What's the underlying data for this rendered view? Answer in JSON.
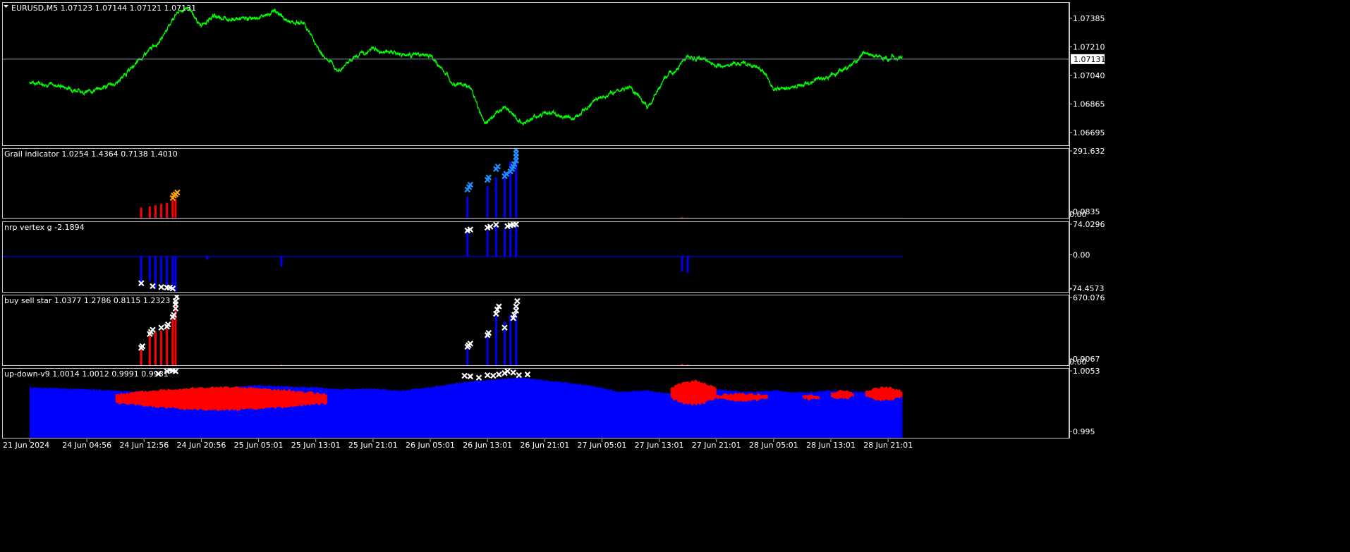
{
  "window": {
    "symbol_title": "EURUSD,M5",
    "ohlc": "1.07123 1.07144 1.07121 1.07131"
  },
  "colors": {
    "background": "#000000",
    "frame": "#c8c8c8",
    "price_line": "#00ff00",
    "bid_line": "#7a8ea8",
    "red": "#ff0000",
    "blue": "#0000ff",
    "light_blue": "#1e90ff",
    "orange": "#ffa500",
    "white": "#ffffff"
  },
  "icons": {
    "dropdown": "triangle-down-icon",
    "marker": "cross-x-icon"
  },
  "time_axis": {
    "labels": [
      "21 Jun 2024",
      "24 Jun 04:56",
      "24 Jun 12:56",
      "24 Jun 20:56",
      "25 Jun 05:01",
      "25 Jun 13:01",
      "25 Jun 21:01",
      "26 Jun 05:01",
      "26 Jun 13:01",
      "26 Jun 21:01",
      "27 Jun 05:01",
      "27 Jun 13:01",
      "27 Jun 21:01",
      "28 Jun 05:01",
      "28 Jun 13:01",
      "28 Jun 21:01"
    ]
  },
  "chart_data": [
    {
      "type": "line",
      "name": "main-price",
      "title": "EURUSD,M5  1.07123 1.07144 1.07121 1.07131",
      "y_ticks": [
        "1.07385",
        "1.07210",
        "1.07040",
        "1.06865",
        "1.06695"
      ],
      "ylim": [
        1.0663,
        1.0746
      ],
      "current_price_label": "1.07131",
      "current_price": 1.07131,
      "x_categories_are_time_axis_labels": true,
      "price_anchors": [
        [
          0,
          1.07
        ],
        [
          0.5,
          1.0698
        ],
        [
          1,
          1.0694
        ],
        [
          1.5,
          1.0699
        ],
        [
          2,
          1.0715
        ],
        [
          2.3,
          1.0725
        ],
        [
          2.55,
          1.0739
        ],
        [
          2.75,
          1.0743
        ],
        [
          3,
          1.0732
        ],
        [
          3.2,
          1.0738
        ],
        [
          3.6,
          1.0736
        ],
        [
          4,
          1.0737
        ],
        [
          4.3,
          1.0741
        ],
        [
          4.5,
          1.0735
        ],
        [
          4.8,
          1.0734
        ],
        [
          5.1,
          1.0716
        ],
        [
          5.4,
          1.0706
        ],
        [
          5.6,
          1.0713
        ],
        [
          6,
          1.0719
        ],
        [
          6.5,
          1.0716
        ],
        [
          7,
          1.0715
        ],
        [
          7.4,
          1.07
        ],
        [
          7.7,
          1.0697
        ],
        [
          7.95,
          1.0676
        ],
        [
          8.3,
          1.0686
        ],
        [
          8.6,
          1.0676
        ],
        [
          9,
          1.0682
        ],
        [
          9.5,
          1.0679
        ],
        [
          10,
          1.0692
        ],
        [
          10.5,
          1.0697
        ],
        [
          10.8,
          1.0685
        ],
        [
          11.1,
          1.0702
        ],
        [
          11.5,
          1.0714
        ],
        [
          11.8,
          1.0713
        ],
        [
          12,
          1.0709
        ],
        [
          12.5,
          1.0711
        ],
        [
          12.8,
          1.0707
        ],
        [
          13,
          1.0695
        ],
        [
          13.3,
          1.0697
        ],
        [
          13.7,
          1.07
        ],
        [
          14,
          1.0704
        ],
        [
          14.3,
          1.0708
        ],
        [
          14.6,
          1.0717
        ],
        [
          15,
          1.0713
        ],
        [
          15.25,
          1.0715
        ]
      ]
    },
    {
      "type": "bar",
      "name": "Grail indicator",
      "title": "Grail indicator 1.0254 1.4364 0.7138 1.4010",
      "y_ticks": [
        "291.632",
        "0.0835",
        "0.00"
      ],
      "ylim": [
        0,
        291.632
      ],
      "series": [
        {
          "name": "red",
          "color": "red",
          "bars": [
            [
              1.95,
              45
            ],
            [
              2.1,
              50
            ],
            [
              2.2,
              55
            ],
            [
              2.3,
              60
            ],
            [
              2.4,
              65
            ],
            [
              2.5,
              75
            ],
            [
              2.55,
              80
            ],
            [
              11.4,
              6
            ],
            [
              11.5,
              4
            ]
          ]
        },
        {
          "name": "blue",
          "color": "blue",
          "bars": [
            [
              7.65,
              90
            ],
            [
              8.0,
              135
            ],
            [
              8.15,
              170
            ],
            [
              8.3,
              190
            ],
            [
              8.4,
              235
            ],
            [
              8.5,
              270
            ]
          ]
        }
      ],
      "markers": [
        {
          "color": "orange",
          "points": [
            [
              2.5,
              85
            ],
            [
              2.52,
              95
            ],
            [
              2.55,
              100
            ],
            [
              2.58,
              108
            ]
          ]
        },
        {
          "color": "light_blue",
          "points": [
            [
              7.65,
              120
            ],
            [
              7.68,
              130
            ],
            [
              7.7,
              140
            ],
            [
              8.0,
              160
            ],
            [
              8.02,
              170
            ],
            [
              8.15,
              205
            ],
            [
              8.18,
              215
            ],
            [
              8.3,
              175
            ],
            [
              8.33,
              185
            ],
            [
              8.4,
              195
            ],
            [
              8.43,
              205
            ],
            [
              8.45,
              215
            ],
            [
              8.47,
              225
            ],
            [
              8.5,
              240
            ],
            [
              8.5,
              255
            ],
            [
              8.5,
              270
            ],
            [
              8.5,
              285
            ]
          ]
        }
      ]
    },
    {
      "type": "bar",
      "name": "nrp vertex g",
      "title": "nrp vertex g -2.1894",
      "y_ticks": [
        "74.0296",
        "0.00",
        "-74.4573"
      ],
      "ylim": [
        -74.4573,
        74.0296
      ],
      "series": [
        {
          "name": "blue",
          "color": "blue",
          "bars": [
            [
              1.95,
              -60
            ],
            [
              2.1,
              -50
            ],
            [
              2.2,
              -65
            ],
            [
              2.3,
              -55
            ],
            [
              2.4,
              -62
            ],
            [
              2.5,
              -70
            ],
            [
              2.55,
              -72
            ],
            [
              3.1,
              -6
            ],
            [
              4.4,
              -20
            ],
            [
              7.65,
              55
            ],
            [
              8.0,
              55
            ],
            [
              8.15,
              65
            ],
            [
              8.3,
              58
            ],
            [
              8.4,
              60
            ],
            [
              8.5,
              65
            ],
            [
              11.4,
              -30
            ],
            [
              11.5,
              -33
            ]
          ]
        }
      ],
      "markers": [
        {
          "color": "white",
          "points": [
            [
              1.95,
              -55
            ],
            [
              2.15,
              -61
            ],
            [
              2.3,
              -63
            ],
            [
              2.4,
              -64
            ],
            [
              2.45,
              -64
            ],
            [
              2.5,
              -66
            ],
            [
              7.65,
              55
            ],
            [
              7.7,
              57
            ],
            [
              8.0,
              61
            ],
            [
              8.05,
              63
            ],
            [
              8.15,
              67
            ],
            [
              8.35,
              64
            ],
            [
              8.4,
              66
            ],
            [
              8.45,
              67
            ],
            [
              8.5,
              68
            ]
          ]
        }
      ]
    },
    {
      "type": "bar",
      "name": "buy sell star",
      "title": "buy sell star 1.0377 1.2786 0.8115 1.2323",
      "y_ticks": [
        "670.076",
        "0.9067",
        "0.00"
      ],
      "ylim": [
        0,
        670.076
      ],
      "series": [
        {
          "name": "red",
          "color": "red",
          "bars": [
            [
              1.95,
              180
            ],
            [
              2.1,
              290
            ],
            [
              2.2,
              320
            ],
            [
              2.3,
              330
            ],
            [
              2.4,
              350
            ],
            [
              2.5,
              440
            ],
            [
              2.55,
              620
            ],
            [
              3.1,
              8
            ],
            [
              4.4,
              12
            ],
            [
              11.4,
              18
            ],
            [
              11.5,
              14
            ]
          ]
        },
        {
          "name": "blue",
          "color": "blue",
          "bars": [
            [
              7.65,
              190
            ],
            [
              8.0,
              310
            ],
            [
              8.15,
              470
            ],
            [
              8.3,
              420
            ],
            [
              8.4,
              480
            ],
            [
              8.5,
              560
            ]
          ]
        }
      ],
      "markers": [
        {
          "color": "white",
          "points": [
            [
              1.95,
              170
            ],
            [
              1.97,
              185
            ],
            [
              2.1,
              300
            ],
            [
              2.12,
              320
            ],
            [
              2.15,
              340
            ],
            [
              2.3,
              360
            ],
            [
              2.4,
              370
            ],
            [
              2.42,
              390
            ],
            [
              2.5,
              460
            ],
            [
              2.52,
              480
            ],
            [
              2.55,
              540
            ],
            [
              2.55,
              580
            ],
            [
              2.55,
              610
            ],
            [
              2.57,
              650
            ],
            [
              7.65,
              180
            ],
            [
              7.67,
              195
            ],
            [
              7.7,
              210
            ],
            [
              8.0,
              290
            ],
            [
              8.02,
              310
            ],
            [
              8.15,
              490
            ],
            [
              8.17,
              530
            ],
            [
              8.2,
              560
            ],
            [
              8.3,
              360
            ],
            [
              8.45,
              450
            ],
            [
              8.47,
              480
            ],
            [
              8.5,
              520
            ],
            [
              8.5,
              560
            ],
            [
              8.52,
              610
            ]
          ]
        }
      ]
    },
    {
      "type": "area",
      "name": "up-down-v9",
      "title": "up-down-v9 1.0014 1.0012 0.9991 0.9981",
      "y_ticks": [
        "1.0053",
        "0.995"
      ],
      "ylim": [
        0.9946,
        1.0055
      ],
      "series": [
        {
          "name": "blue-area",
          "color": "blue",
          "top": [
            [
              0,
              1.0025
            ],
            [
              1,
              1.0022
            ],
            [
              2,
              1.0018
            ],
            [
              2.5,
              1.002
            ],
            [
              3,
              1.0022
            ],
            [
              4,
              1.0028
            ],
            [
              5,
              1.0025
            ],
            [
              5.4,
              1.0022
            ],
            [
              6,
              1.0023
            ],
            [
              6.5,
              1.002
            ],
            [
              7,
              1.0025
            ],
            [
              7.5,
              1.0032
            ],
            [
              8.2,
              1.0038
            ],
            [
              8.6,
              1.004
            ],
            [
              9.0,
              1.0036
            ],
            [
              9.8,
              1.0028
            ],
            [
              10.3,
              1.0018
            ],
            [
              10.8,
              1.002
            ],
            [
              11.2,
              1.0015
            ],
            [
              11.5,
              1.0014
            ],
            [
              12,
              1.0022
            ],
            [
              12.5,
              1.0018
            ],
            [
              13,
              1.002
            ],
            [
              13.5,
              1.0017
            ],
            [
              14,
              1.002
            ],
            [
              14.5,
              1.0018
            ],
            [
              15,
              1.0017
            ],
            [
              15.25,
              1.0016
            ]
          ]
        },
        {
          "name": "red-bands",
          "color": "red",
          "bands": [
            [
              1.5,
              5.2,
              1.0025,
              0.999
            ],
            [
              11.2,
              12.0,
              1.0035,
              0.9998
            ],
            [
              12.0,
              12.9,
              1.0016,
              1.0004
            ],
            [
              13.5,
              13.8,
              1.0014,
              1.0006
            ],
            [
              14.0,
              14.4,
              1.002,
              1.0007
            ],
            [
              14.6,
              15.25,
              1.0025,
              1.0005
            ]
          ]
        }
      ],
      "markers": [
        {
          "color": "white",
          "points": [
            [
              2.25,
              1.0046
            ],
            [
              2.4,
              1.005
            ],
            [
              2.45,
              1.0052
            ],
            [
              2.5,
              1.0051
            ],
            [
              2.55,
              1.005
            ],
            [
              7.6,
              1.0043
            ],
            [
              7.7,
              1.0042
            ],
            [
              7.85,
              1.004
            ],
            [
              8.0,
              1.0044
            ],
            [
              8.1,
              1.0043
            ],
            [
              8.2,
              1.0045
            ],
            [
              8.3,
              1.0047
            ],
            [
              8.35,
              1.005
            ],
            [
              8.45,
              1.0048
            ],
            [
              8.55,
              1.0044
            ],
            [
              8.7,
              1.0045
            ]
          ]
        }
      ]
    }
  ]
}
